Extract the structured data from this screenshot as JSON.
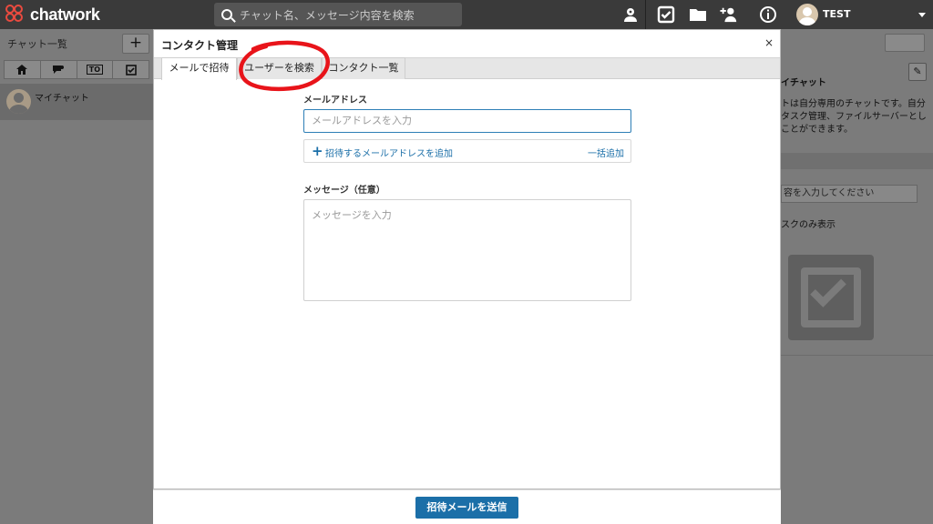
{
  "header": {
    "brand": "chatwork",
    "search_placeholder": "チャット名、メッセージ内容を検索",
    "user_name": "TEST",
    "icons": [
      "contact-icon",
      "task-icon",
      "folder-icon",
      "add-contact-icon",
      "info-icon",
      "avatar"
    ]
  },
  "sidebar": {
    "title": "チャット一覧",
    "add_label": "+",
    "filter_todo_label": "TO",
    "chat_item": "マイチャット"
  },
  "modal": {
    "title": "コンタクト管理",
    "close_label": "×",
    "tabs": [
      {
        "label": "メールで招待"
      },
      {
        "label": "ユーザーを検索"
      },
      {
        "label": "コンタクト一覧"
      }
    ],
    "email_label": "メールアドレス",
    "email_placeholder": "メールアドレスを入力",
    "add_email_label": "招待するメールアドレスを追加",
    "bulk_add_label": "一括追加",
    "message_label": "メッセージ（任意）",
    "message_placeholder": "メッセージを入力",
    "send_button": "招待メールを送信"
  },
  "right_panel": {
    "chat_title": "イチャット",
    "description": "トは自分専用のチャットです。自分タスク管理、ファイルサーバーとしことができます。",
    "task_input_placeholder": "容を入力してください",
    "my_task_label": "スクのみ表示"
  },
  "colors": {
    "accent": "#1b6fa8",
    "header_bg": "#3a3a3a",
    "annotation": "#e8141a"
  }
}
